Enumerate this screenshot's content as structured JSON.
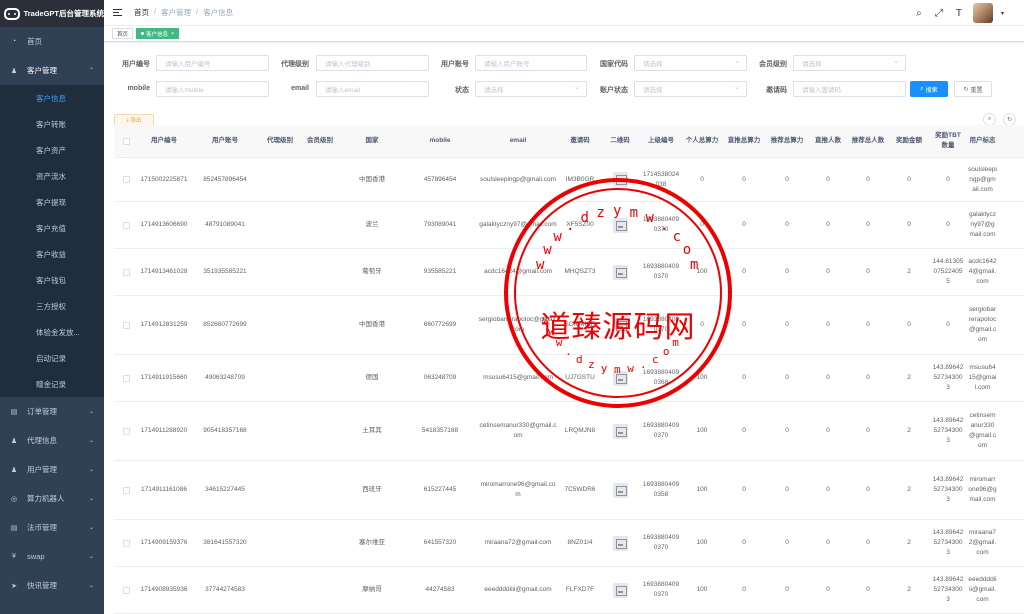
{
  "app": {
    "title": "TradeGPT后台管理系统"
  },
  "sidebar": {
    "items": [
      {
        "label": "首页",
        "icon": "dashboard-icon"
      },
      {
        "label": "客户管理",
        "icon": "user-icon",
        "expanded": true,
        "children": [
          "客户信息",
          "客户转账",
          "客户资产",
          "资产流水",
          "客户提现",
          "客户充值",
          "客户收益",
          "客户钱包",
          "三方授权",
          "体验金发放...",
          "启动记录",
          "赠金记录"
        ]
      },
      {
        "label": "订单管理",
        "icon": "order-icon"
      },
      {
        "label": "代理信息",
        "icon": "agent-icon"
      },
      {
        "label": "用户管理",
        "icon": "users-icon"
      },
      {
        "label": "算力机器人",
        "icon": "robot-icon"
      },
      {
        "label": "法币管理",
        "icon": "fiat-icon"
      },
      {
        "label": "swap",
        "icon": "yen-icon"
      },
      {
        "label": "快讯管理",
        "icon": "send-icon"
      }
    ]
  },
  "breadcrumb": [
    "首页",
    "客户管理",
    "客户信息"
  ],
  "tags": [
    "首页",
    "客户信息"
  ],
  "search": {
    "user_no": {
      "label": "用户编号",
      "placeholder": "请输入用户编号"
    },
    "agent_level": {
      "label": "代理级别",
      "placeholder": "请输入代理级别"
    },
    "user_account": {
      "label": "用户账号",
      "placeholder": "请输入用户账号"
    },
    "country_code": {
      "label": "国家代码",
      "placeholder": "请选择"
    },
    "member_level": {
      "label": "会员级别",
      "placeholder": "请选择"
    },
    "mobile": {
      "label": "mobile",
      "placeholder": "请输入mobile"
    },
    "email": {
      "label": "email",
      "placeholder": "请输入email"
    },
    "status": {
      "label": "状态",
      "placeholder": "请选择"
    },
    "account_status": {
      "label": "账户状态",
      "placeholder": "请选择"
    },
    "invite": {
      "label": "邀请码",
      "placeholder": "请输入邀请码"
    },
    "search_btn": "搜索",
    "reset_btn": "重置"
  },
  "toolbar": {
    "export": "导出"
  },
  "table": {
    "headers": [
      "用户编号",
      "用户账号",
      "代理级别",
      "会员级别",
      "国家",
      "mobile",
      "email",
      "邀请码",
      "二维码",
      "上级编号",
      "个人总算力",
      "直推总算力",
      "推荐总算力",
      "直推人数",
      "推荐总人数",
      "奖励金额",
      "奖励TBT数量",
      "用户标志"
    ],
    "rows": [
      [
        "1715002225871",
        "852457896454",
        "",
        "",
        "中国香港",
        "457896454",
        "soulsleepingp@gmail.com",
        "IM3B0GR",
        "",
        "1714538024038",
        "0",
        "0",
        "0",
        "0",
        "0",
        "0",
        "0",
        "soulsleepingp@gmail.com"
      ],
      [
        "1714913606690",
        "48791089041",
        "",
        "",
        "波兰",
        "793089041",
        "galaktyczny97@gmail.com",
        "XF5SZ00",
        "",
        "16938804090370",
        "0",
        "0",
        "0",
        "0",
        "0",
        "0",
        "0",
        "galaktyczny97@gmail.com"
      ],
      [
        "1714913461028",
        "351935585221",
        "",
        "",
        "葡萄牙",
        "935585221",
        "acdc16424@gmail.com",
        "MHQSZT3",
        "",
        "16938804090370",
        "100",
        "0",
        "0",
        "0",
        "0",
        "2",
        "144.61305075224055",
        "acdc16424@gmail.com"
      ],
      [
        "1714912831259",
        "852660772699",
        "",
        "",
        "中国香港",
        "660772699",
        "sergiobarrerapotoc@gmail.com",
        "SOIQMCR",
        "",
        "16938804090370",
        "0",
        "0",
        "0",
        "0",
        "0",
        "0",
        "0",
        "sergiobarrerapotoc@gmail.com"
      ],
      [
        "1714911915660",
        "49063248709",
        "",
        "",
        "德国",
        "063248709",
        "msusu6415@gmail.com",
        "UJ7GSTU",
        "",
        "16938804090368",
        "100",
        "0",
        "0",
        "0",
        "0",
        "2",
        "143.89642527343003",
        "msusu6415@gmail.com"
      ],
      [
        "1714911288920",
        "905418357168",
        "",
        "",
        "土耳其",
        "5418357168",
        "cetinsemanur330@gmail.com",
        "LRQMJN8",
        "",
        "16938804090370",
        "100",
        "0",
        "0",
        "0",
        "0",
        "2",
        "143.89642527343003",
        "cetinsemanur330@gmail.com"
      ],
      [
        "1714911161086",
        "34615227445",
        "",
        "",
        "西班牙",
        "615227445",
        "miromarrone96@gmail.com",
        "7C5WDR6",
        "",
        "16938804090358",
        "100",
        "0",
        "0",
        "0",
        "0",
        "2",
        "143.89642527343003",
        "miromarrone96@gmail.com"
      ],
      [
        "1714909159376",
        "381641557320",
        "",
        "",
        "塞尔维亚",
        "641557320",
        "miraana72@gmail.com",
        "8NZ01I4",
        "",
        "16938804090370",
        "100",
        "0",
        "0",
        "0",
        "0",
        "2",
        "143.89642527343003",
        "miraana72@gmail.com"
      ],
      [
        "1714908935936",
        "37744274583",
        "",
        "",
        "摩纳哥",
        "44274583",
        "eeeddddiiii@gmail.com",
        "FLFXD7F",
        "",
        "16938804090370",
        "100",
        "0",
        "0",
        "0",
        "0",
        "2",
        "143.89642527343003",
        "eeeddddiiii@gmail.com"
      ]
    ]
  },
  "watermark": {
    "text": "道臻源码网",
    "url": "www.dzymw.com"
  }
}
